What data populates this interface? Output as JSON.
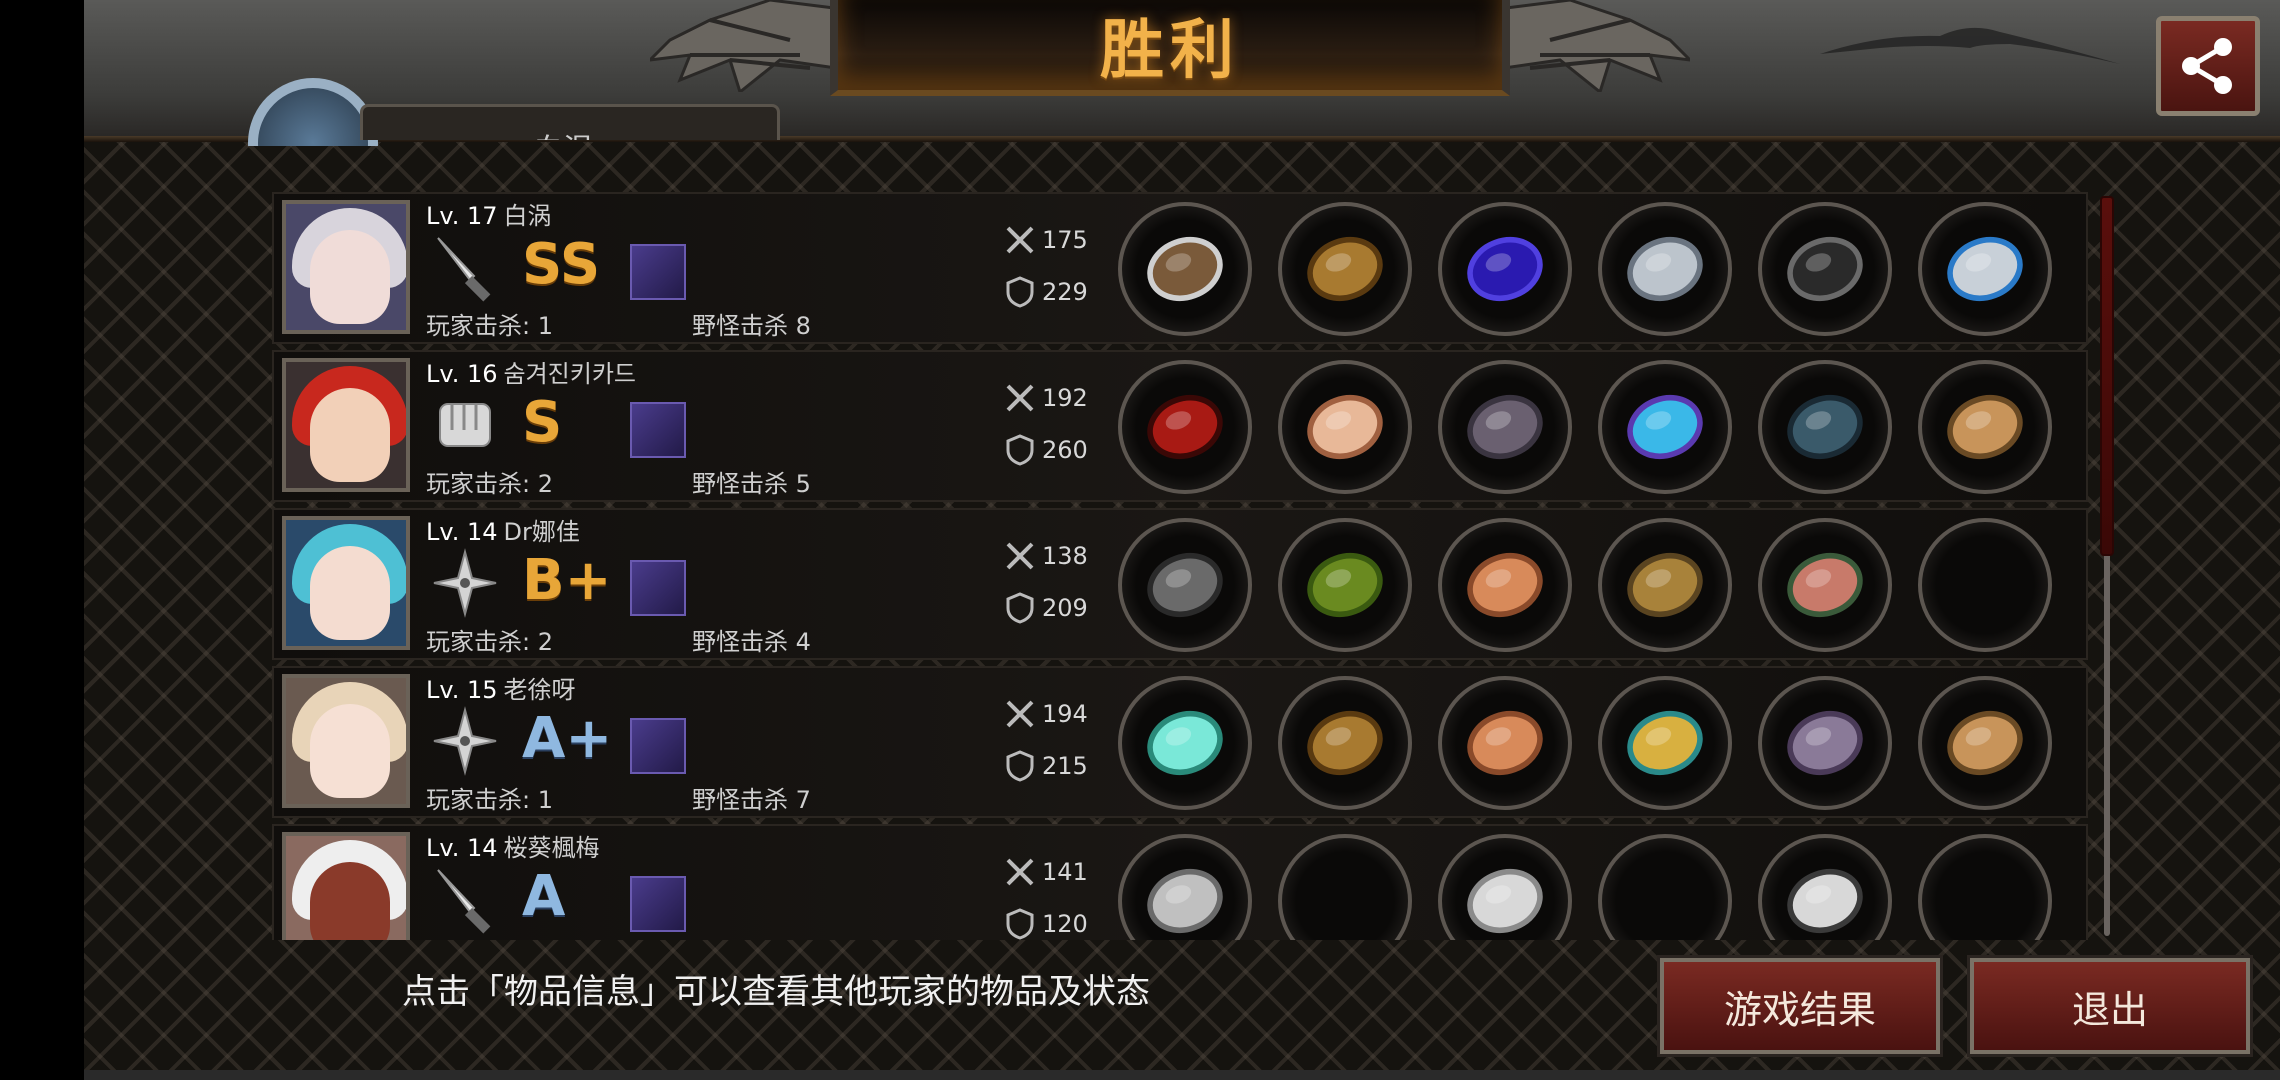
{
  "header": {
    "title": "胜利",
    "tab_label_partial": "白涡",
    "share_icon": "share-icon"
  },
  "players": [
    {
      "level": "Lv. 17",
      "name": "白涡",
      "weapon_icon": "knife-icon",
      "rank": "SS",
      "player_kills": "玩家击杀: 1",
      "monster_kills": "野怪击杀 8",
      "attack": "175",
      "defense": "229",
      "items": [
        "axe-icon",
        "golden-helmet-icon",
        "blue-robe-icon",
        "silver-gauntlet-icon",
        "black-boots-icon",
        "blue-gem-necklace-icon"
      ]
    },
    {
      "level": "Lv. 16",
      "name": "숨겨진키카드",
      "weapon_icon": "fist-icon",
      "rank": "S",
      "player_kills": "玩家击杀: 2",
      "monster_kills": "野怪击杀 5",
      "attack": "192",
      "defense": "260",
      "items": [
        "red-mask-helmet-icon",
        "bone-wing-icon",
        "stone-armor-icon",
        "crystal-gauntlet-icon",
        "steel-boots-icon",
        "treasure-box-icon"
      ]
    },
    {
      "level": "Lv. 14",
      "name": "Dr娜佳",
      "weapon_icon": "shuriken-icon",
      "rank": "B+",
      "player_kills": "玩家击杀: 2",
      "monster_kills": "野怪击杀 4",
      "attack": "138",
      "defense": "209",
      "items": [
        "boomerang-icon",
        "laurel-wreath-icon",
        "scale-armor-icon",
        "whip-icon",
        "bracer-icon",
        "empty-slot"
      ]
    },
    {
      "level": "Lv. 15",
      "name": "老徐呀",
      "weapon_icon": "shuriken-icon",
      "rank": "A+",
      "player_kills": "玩家击杀: 1",
      "monster_kills": "野怪击杀 7",
      "attack": "194",
      "defense": "215",
      "items": [
        "twin-blades-icon",
        "golden-helmet-icon",
        "scale-armor-icon",
        "gold-bracelet-icon",
        "leather-boots-icon",
        "treasure-box-icon"
      ]
    },
    {
      "level": "Lv. 14",
      "name": "桜葵楓梅",
      "weapon_icon": "knife-icon",
      "rank": "A",
      "player_kills": "",
      "monster_kills": "",
      "attack": "141",
      "defense": "120",
      "items": [
        "longsword-icon",
        "empty-slot",
        "cross-armor-icon",
        "empty-slot",
        "silver-greaves-icon",
        "empty-slot"
      ]
    }
  ],
  "footer": {
    "hint": "点击「物品信息」可以查看其他玩家的物品及状态",
    "results_button": "游戏结果",
    "exit_button": "退出"
  },
  "colors": {
    "title_gold": "#f2b24a",
    "button_red": "#7a2a22",
    "rank_gold": "#e8a638",
    "rank_blue": "#8fb8e0"
  }
}
